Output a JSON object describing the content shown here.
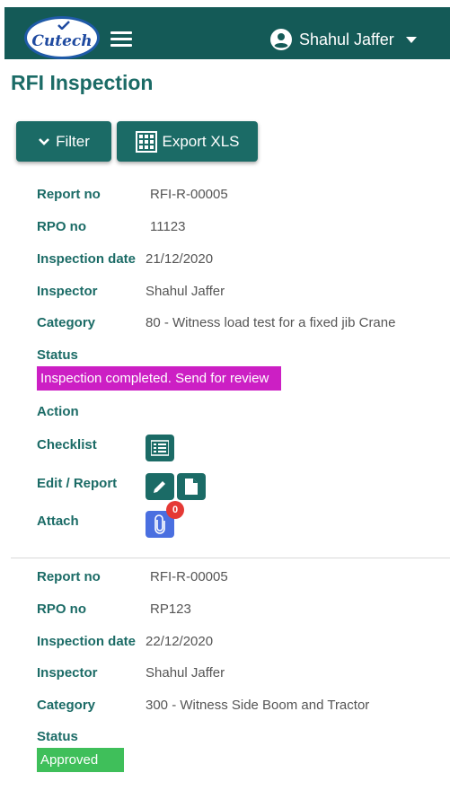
{
  "header": {
    "user_name": "Shahul Jaffer",
    "logo_text": "Cutech",
    "brand_color": "#145a57"
  },
  "page": {
    "title": "RFI Inspection"
  },
  "toolbar": {
    "filter_label": "Filter",
    "export_label": "Export XLS"
  },
  "labels": {
    "report_no": "Report no",
    "rpo_no": "RPO no",
    "inspection_date": "Inspection date",
    "inspector": "Inspector",
    "category": "Category",
    "status": "Status",
    "action": "Action",
    "checklist": "Checklist",
    "edit_report": "Edit / Report",
    "attach": "Attach"
  },
  "records": [
    {
      "report_no": "RFI-R-00005",
      "rpo_no": "11123",
      "inspection_date": "21/12/2020",
      "inspector": "Shahul Jaffer",
      "category": "80 - Witness load test for a fixed jib Crane",
      "status": "Inspection completed. Send for review",
      "status_color": "#cc1fc4",
      "attach_count": "0"
    },
    {
      "report_no": "RFI-R-00005",
      "rpo_no": "RP123",
      "inspection_date": "22/12/2020",
      "inspector": "Shahul Jaffer",
      "category": "300 - Witness Side Boom and Tractor",
      "status": "Approved",
      "status_color": "#3fbf5a"
    }
  ]
}
